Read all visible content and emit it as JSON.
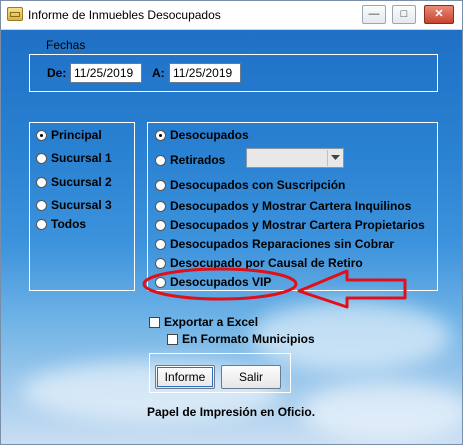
{
  "window": {
    "title": "Informe de Inmuebles Desocupados",
    "minimize_icon": "minimize-icon",
    "maximize_icon": "maximize-icon",
    "close_icon": "close-icon"
  },
  "fechas": {
    "group_label": "Fechas",
    "de_label": "De:",
    "de_value": "11/25/2019",
    "a_label": "A:",
    "a_value": "11/25/2019"
  },
  "sucursal": {
    "options": [
      {
        "label": "Principal",
        "selected": true
      },
      {
        "label": "Sucursal 1",
        "selected": false
      },
      {
        "label": "Sucursal 2",
        "selected": false
      },
      {
        "label": "Sucursal 3",
        "selected": false
      },
      {
        "label": "Todos",
        "selected": false
      }
    ]
  },
  "report_type": {
    "options": [
      {
        "label": "Desocupados",
        "selected": true
      },
      {
        "label": "Retirados",
        "selected": false
      },
      {
        "label": "Desocupados con Suscripción",
        "selected": false
      },
      {
        "label": "Desocupados y Mostrar Cartera Inquilinos",
        "selected": false
      },
      {
        "label": "Desocupados y Mostrar Cartera Propietarios",
        "selected": false
      },
      {
        "label": "Desocupados Reparaciones sin Cobrar",
        "selected": false
      },
      {
        "label": "Desocupado por Causal de Retiro",
        "selected": false
      },
      {
        "label": "Desocupados VIP",
        "selected": false
      }
    ],
    "retirados_combo_value": ""
  },
  "excel": {
    "export_label": "Exportar a Excel",
    "export_checked": false,
    "municipios_label": "En Formato Municipios",
    "municipios_checked": false
  },
  "buttons": {
    "informe": "Informe",
    "salir": "Salir"
  },
  "footer_note": "Papel de Impresión en Oficio.",
  "annotation": {
    "color": "#e0101a",
    "shape": "ellipse-with-arrow"
  }
}
